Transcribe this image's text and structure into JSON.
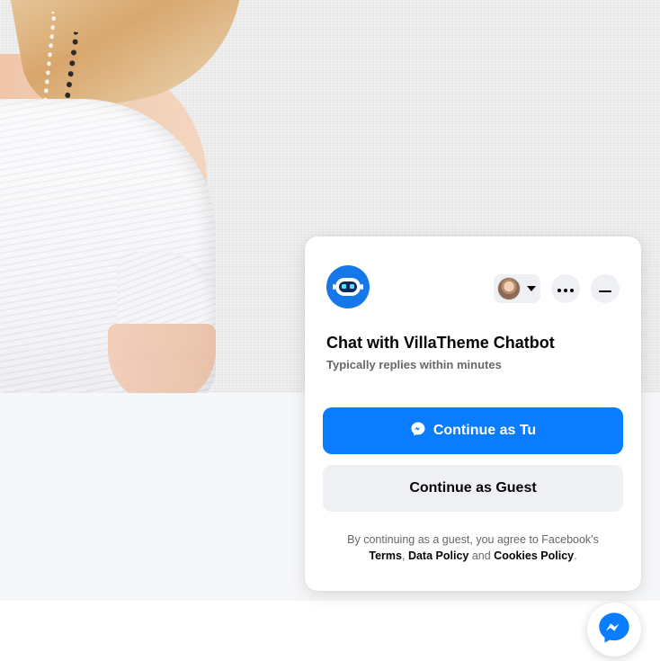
{
  "chat": {
    "title": "Chat with VillaTheme Chatbot",
    "subtitle": "Typically replies within minutes",
    "continue_as_user_label": "Continue as Tu",
    "continue_as_guest_label": "Continue as Guest",
    "legal": {
      "prefix": "By continuing as a guest, you agree to Facebook's",
      "terms": "Terms",
      "sep1": ",",
      "data_policy": "Data Policy",
      "and": "and",
      "cookies_policy": "Cookies Policy",
      "end": "."
    }
  },
  "icons": {
    "bot_avatar": "robot-icon",
    "user_avatar": "user-photo",
    "dropdown": "caret-down-icon",
    "more": "more-dots-icon",
    "minimize": "minimize-icon",
    "messenger": "messenger-icon"
  },
  "colors": {
    "primary": "#0a7cff",
    "bot_avatar_bg": "#1677e8",
    "secondary_bg": "#eef0f3",
    "text": "#050505",
    "muted": "#65676b"
  }
}
